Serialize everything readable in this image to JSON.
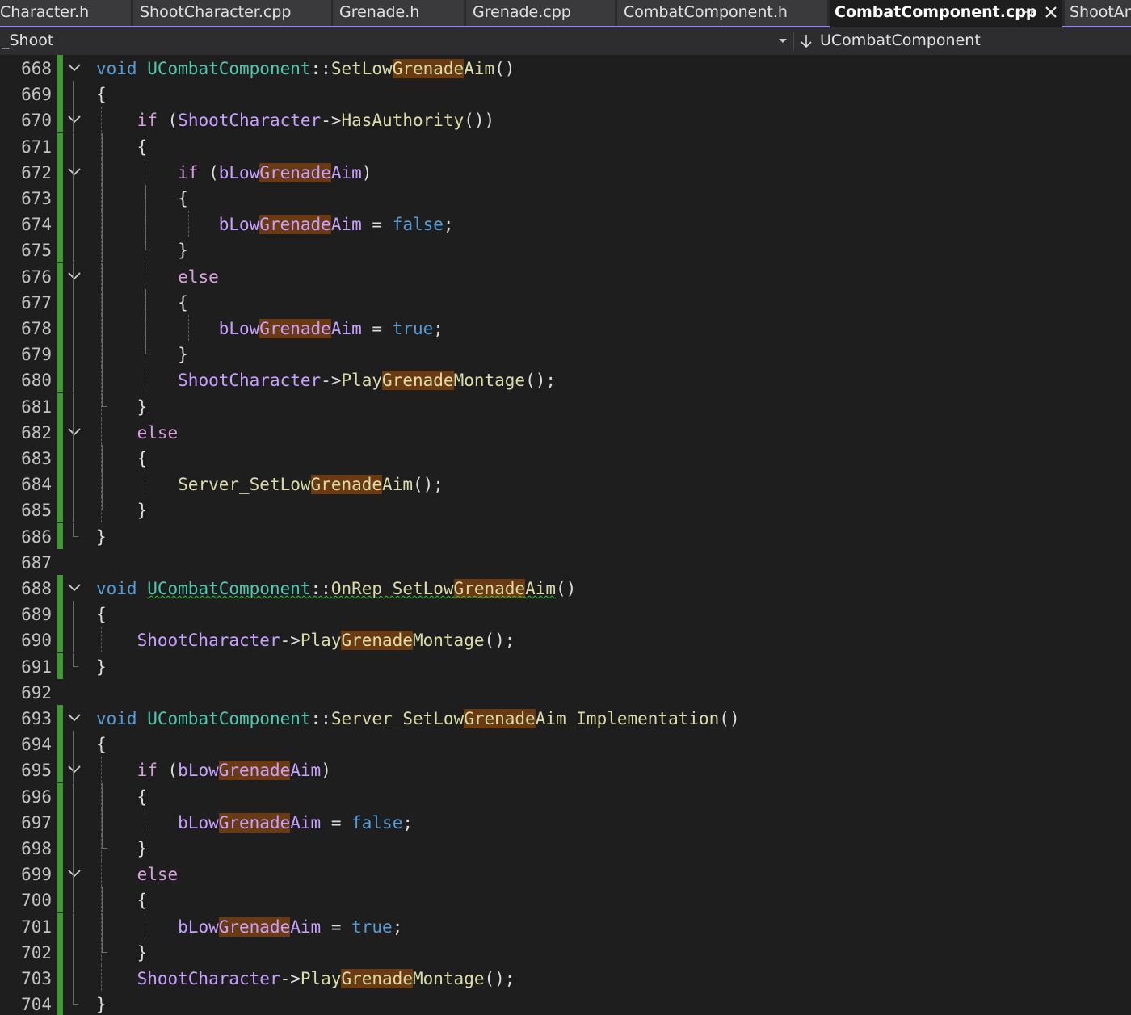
{
  "tabs": [
    {
      "label": "Character.h",
      "active": false
    },
    {
      "label": "ShootCharacter.cpp",
      "active": false
    },
    {
      "label": "Grenade.h",
      "active": false
    },
    {
      "label": "Grenade.cpp",
      "active": false
    },
    {
      "label": "CombatComponent.h",
      "active": false
    },
    {
      "label": "CombatComponent.cpp",
      "active": true
    },
    {
      "label": "ShootAni",
      "active": false
    }
  ],
  "navbar": {
    "project": "_Shoot",
    "scope": "UCombatComponent"
  },
  "lines": [
    {
      "num": "668",
      "tokens": [
        [
          "kw",
          "void"
        ],
        [
          "p",
          " "
        ],
        [
          "ty",
          "UCombatComponent"
        ],
        [
          "p",
          "::"
        ],
        [
          "fn",
          "SetLow"
        ],
        [
          "fnh",
          "Grenade"
        ],
        [
          "fn",
          "Aim"
        ],
        [
          "p",
          "()"
        ]
      ]
    },
    {
      "num": "669",
      "tokens": [
        [
          "p",
          "{"
        ]
      ]
    },
    {
      "num": "670",
      "tokens": [
        [
          "p",
          "    "
        ],
        [
          "ctl",
          "if"
        ],
        [
          "p",
          " ("
        ],
        [
          "var",
          "ShootCharacter"
        ],
        [
          "p",
          "->"
        ],
        [
          "fn",
          "HasAuthority"
        ],
        [
          "p",
          "())"
        ]
      ]
    },
    {
      "num": "671",
      "tokens": [
        [
          "p",
          "    {"
        ]
      ]
    },
    {
      "num": "672",
      "tokens": [
        [
          "p",
          "        "
        ],
        [
          "ctl",
          "if"
        ],
        [
          "p",
          " ("
        ],
        [
          "var",
          "bLow"
        ],
        [
          "varh",
          "Grenade"
        ],
        [
          "var",
          "Aim"
        ],
        [
          "p",
          ")"
        ]
      ]
    },
    {
      "num": "673",
      "tokens": [
        [
          "p",
          "        {"
        ]
      ]
    },
    {
      "num": "674",
      "tokens": [
        [
          "p",
          "            "
        ],
        [
          "var",
          "bLow"
        ],
        [
          "varh",
          "Grenade"
        ],
        [
          "var",
          "Aim"
        ],
        [
          "p",
          " = "
        ],
        [
          "kw",
          "false"
        ],
        [
          "p",
          ";"
        ]
      ]
    },
    {
      "num": "675",
      "tokens": [
        [
          "p",
          "        }"
        ]
      ]
    },
    {
      "num": "676",
      "tokens": [
        [
          "p",
          "        "
        ],
        [
          "ctl",
          "else"
        ]
      ]
    },
    {
      "num": "677",
      "tokens": [
        [
          "p",
          "        {"
        ]
      ]
    },
    {
      "num": "678",
      "tokens": [
        [
          "p",
          "            "
        ],
        [
          "var",
          "bLow"
        ],
        [
          "varh",
          "Grenade"
        ],
        [
          "var",
          "Aim"
        ],
        [
          "p",
          " = "
        ],
        [
          "kw",
          "true"
        ],
        [
          "p",
          ";"
        ]
      ]
    },
    {
      "num": "679",
      "tokens": [
        [
          "p",
          "        }"
        ]
      ]
    },
    {
      "num": "680",
      "tokens": [
        [
          "p",
          "        "
        ],
        [
          "var",
          "ShootCharacter"
        ],
        [
          "p",
          "->"
        ],
        [
          "fn",
          "Play"
        ],
        [
          "fnh",
          "Grenade"
        ],
        [
          "fn",
          "Montage"
        ],
        [
          "p",
          "();"
        ]
      ]
    },
    {
      "num": "681",
      "tokens": [
        [
          "p",
          "    }"
        ]
      ]
    },
    {
      "num": "682",
      "tokens": [
        [
          "p",
          "    "
        ],
        [
          "ctl",
          "else"
        ]
      ]
    },
    {
      "num": "683",
      "tokens": [
        [
          "p",
          "    {"
        ]
      ]
    },
    {
      "num": "684",
      "tokens": [
        [
          "p",
          "        "
        ],
        [
          "fn",
          "Server_SetLow"
        ],
        [
          "fnh",
          "Grenade"
        ],
        [
          "fn",
          "Aim"
        ],
        [
          "p",
          "();"
        ]
      ]
    },
    {
      "num": "685",
      "tokens": [
        [
          "p",
          "    }"
        ]
      ]
    },
    {
      "num": "686",
      "tokens": [
        [
          "p",
          "}"
        ]
      ]
    },
    {
      "num": "687",
      "tokens": []
    },
    {
      "num": "688",
      "tokens": [
        [
          "kw",
          "void"
        ],
        [
          "p",
          " "
        ],
        [
          "tys",
          "UCombatComponent"
        ],
        [
          "ps",
          "::"
        ],
        [
          "fns",
          "OnRep_SetLow"
        ],
        [
          "fnhs",
          "Grenade"
        ],
        [
          "fns",
          "Aim"
        ],
        [
          "p",
          "()"
        ]
      ]
    },
    {
      "num": "689",
      "tokens": [
        [
          "p",
          "{"
        ]
      ]
    },
    {
      "num": "690",
      "tokens": [
        [
          "p",
          "    "
        ],
        [
          "var",
          "ShootCharacter"
        ],
        [
          "p",
          "->"
        ],
        [
          "fn",
          "Play"
        ],
        [
          "fnh",
          "Grenade"
        ],
        [
          "fn",
          "Montage"
        ],
        [
          "p",
          "();"
        ]
      ]
    },
    {
      "num": "691",
      "tokens": [
        [
          "p",
          "}"
        ]
      ]
    },
    {
      "num": "692",
      "tokens": []
    },
    {
      "num": "693",
      "tokens": [
        [
          "kw",
          "void"
        ],
        [
          "p",
          " "
        ],
        [
          "ty",
          "UCombatComponent"
        ],
        [
          "p",
          "::"
        ],
        [
          "fn",
          "Server_SetLow"
        ],
        [
          "fnh",
          "Grenade"
        ],
        [
          "fn",
          "Aim_Implementation"
        ],
        [
          "p",
          "()"
        ]
      ]
    },
    {
      "num": "694",
      "tokens": [
        [
          "p",
          "{"
        ]
      ]
    },
    {
      "num": "695",
      "tokens": [
        [
          "p",
          "    "
        ],
        [
          "ctl",
          "if"
        ],
        [
          "p",
          " ("
        ],
        [
          "var",
          "bLow"
        ],
        [
          "varh",
          "Grenade"
        ],
        [
          "var",
          "Aim"
        ],
        [
          "p",
          ")"
        ]
      ]
    },
    {
      "num": "696",
      "tokens": [
        [
          "p",
          "    {"
        ]
      ]
    },
    {
      "num": "697",
      "tokens": [
        [
          "p",
          "        "
        ],
        [
          "var",
          "bLow"
        ],
        [
          "varh",
          "Grenade"
        ],
        [
          "var",
          "Aim"
        ],
        [
          "p",
          " = "
        ],
        [
          "kw",
          "false"
        ],
        [
          "p",
          ";"
        ]
      ]
    },
    {
      "num": "698",
      "tokens": [
        [
          "p",
          "    }"
        ]
      ]
    },
    {
      "num": "699",
      "tokens": [
        [
          "p",
          "    "
        ],
        [
          "ctl",
          "else"
        ]
      ]
    },
    {
      "num": "700",
      "tokens": [
        [
          "p",
          "    {"
        ]
      ]
    },
    {
      "num": "701",
      "tokens": [
        [
          "p",
          "        "
        ],
        [
          "var",
          "bLow"
        ],
        [
          "varh",
          "Grenade"
        ],
        [
          "var",
          "Aim"
        ],
        [
          "p",
          " = "
        ],
        [
          "kw",
          "true"
        ],
        [
          "p",
          ";"
        ]
      ]
    },
    {
      "num": "702",
      "tokens": [
        [
          "p",
          "    }"
        ]
      ]
    },
    {
      "num": "703",
      "tokens": [
        [
          "p",
          "    "
        ],
        [
          "var",
          "ShootCharacter"
        ],
        [
          "p",
          "->"
        ],
        [
          "fn",
          "Play"
        ],
        [
          "fnh",
          "Grenade"
        ],
        [
          "fn",
          "Montage"
        ],
        [
          "p",
          "();"
        ]
      ]
    },
    {
      "num": "704",
      "tokens": [
        [
          "p",
          "}"
        ]
      ]
    }
  ]
}
